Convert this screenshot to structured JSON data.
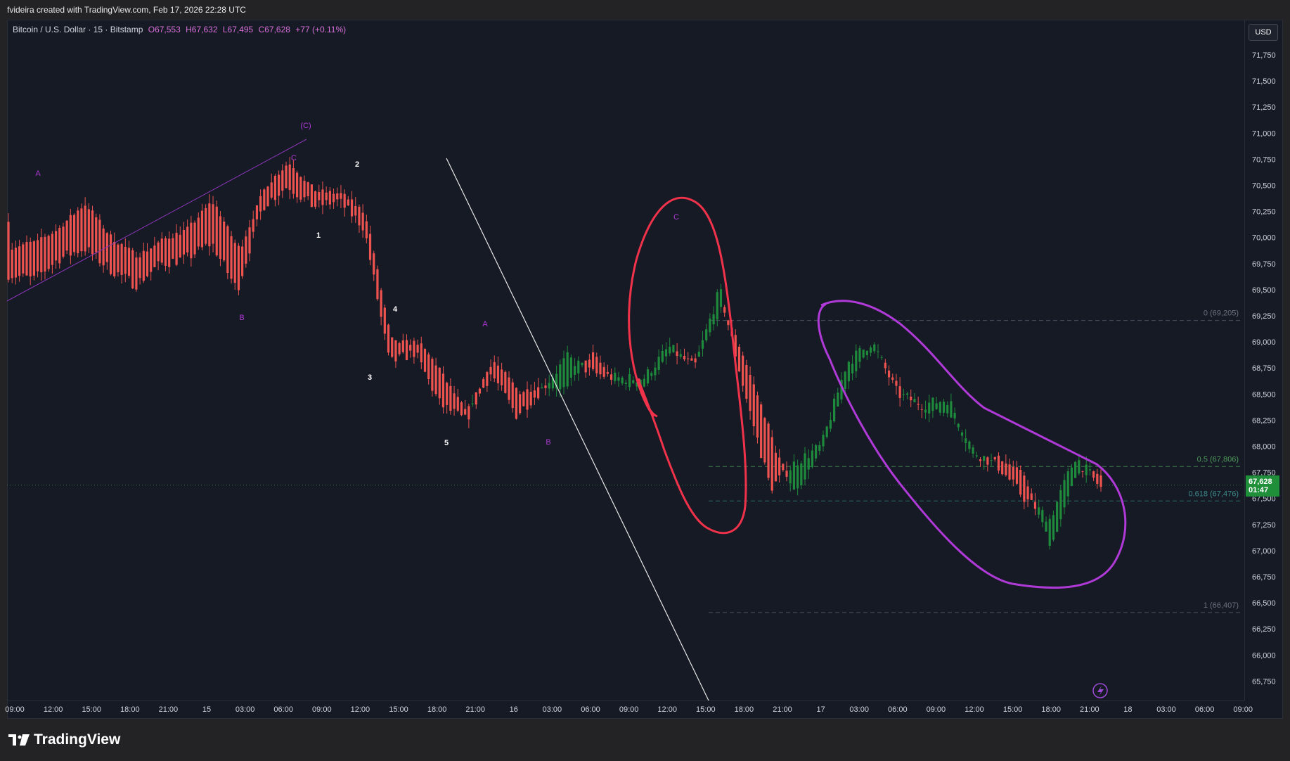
{
  "topline": "fvideira created with TradingView.com, Feb 17, 2026 22:28 UTC",
  "legend": {
    "symbol": "Bitcoin / U.S. Dollar · 15 · Bitstamp",
    "open": "O67,553",
    "high": "H67,632",
    "low": "L67,495",
    "close": "C67,628",
    "change": "+77 (+0.11%)"
  },
  "currency": "USD",
  "last_price": {
    "price": "67,628",
    "countdown": "01:47"
  },
  "price_ticks": [
    "71,750",
    "71,500",
    "71,250",
    "71,000",
    "70,750",
    "70,500",
    "70,250",
    "70,000",
    "69,750",
    "69,500",
    "69,250",
    "69,000",
    "68,750",
    "68,500",
    "68,250",
    "68,000",
    "67,750",
    "67,500",
    "67,250",
    "67,000",
    "66,750",
    "66,500",
    "66,250",
    "66,000",
    "65,750"
  ],
  "time_ticks": [
    "09:00",
    "12:00",
    "15:00",
    "18:00",
    "21:00",
    "15",
    "03:00",
    "06:00",
    "09:00",
    "12:00",
    "15:00",
    "18:00",
    "21:00",
    "16",
    "03:00",
    "06:00",
    "09:00",
    "12:00",
    "15:00",
    "18:00",
    "21:00",
    "17",
    "03:00",
    "06:00",
    "09:00",
    "12:00",
    "15:00",
    "18:00",
    "21:00",
    "18",
    "03:00",
    "06:00",
    "09:00"
  ],
  "fib_levels": [
    {
      "label": "0 (69,205)",
      "price": 69205
    },
    {
      "label": "0.5 (67,806)",
      "price": 67806
    },
    {
      "label": "0.618 (67,476)",
      "price": 67476
    },
    {
      "label": "1 (66,407)",
      "price": 66407
    }
  ],
  "wave_labels": [
    {
      "text": "(C)",
      "color": "purple"
    },
    {
      "text": "A",
      "color": "purple"
    },
    {
      "text": "B",
      "color": "purple"
    },
    {
      "text": "C",
      "color": "purple"
    },
    {
      "text": "1",
      "color": "white"
    },
    {
      "text": "2",
      "color": "white"
    },
    {
      "text": "3",
      "color": "white"
    },
    {
      "text": "4",
      "color": "white"
    },
    {
      "text": "5",
      "color": "white"
    },
    {
      "text": "A",
      "color": "purple"
    },
    {
      "text": "B",
      "color": "purple"
    },
    {
      "text": "C",
      "color": "purple"
    }
  ],
  "colors": {
    "up": "#26a69a",
    "up_candle": "#1e8a3c",
    "down": "#ef5350",
    "purple": "#b03ad8",
    "red_drawing": "#f0324a",
    "background": "#161a25"
  },
  "footer": "TradingView",
  "chart_data": {
    "type": "candlestick",
    "symbol": "BTCUSD",
    "timeframe": "15",
    "ylim": [
      65600,
      71900
    ],
    "y_scale": "linear",
    "grid": false,
    "path_points": [
      [
        70150,
        69650
      ],
      [
        70300,
        69600
      ],
      [
        70400,
        69800
      ],
      [
        70750,
        69900
      ],
      [
        70300,
        69700
      ],
      [
        70100,
        69550
      ],
      [
        70200,
        69750
      ],
      [
        70350,
        69800
      ],
      [
        70750,
        69950
      ],
      [
        70250,
        69500
      ],
      [
        70650,
        70300
      ],
      [
        70950,
        70500
      ],
      [
        70600,
        70300
      ],
      [
        70500,
        70350
      ],
      [
        70350,
        70100
      ],
      [
        69200,
        68800
      ],
      [
        69100,
        68900
      ],
      [
        69000,
        68400
      ],
      [
        68400,
        68250
      ],
      [
        68950,
        68700
      ],
      [
        68750,
        68300
      ],
      [
        68650,
        68550
      ],
      [
        68300,
        68850
      ],
      [
        69050,
        68700
      ],
      [
        68550,
        68650
      ],
      [
        68500,
        68650
      ],
      [
        68850,
        68950
      ],
      [
        68850,
        68750
      ],
      [
        69200,
        69500
      ],
      [
        69000,
        68500
      ],
      [
        68550,
        67600
      ],
      [
        67300,
        67850
      ],
      [
        67950,
        68000
      ],
      [
        68500,
        68800
      ],
      [
        68900,
        69000
      ],
      [
        68600,
        68500
      ],
      [
        68300,
        68400
      ],
      [
        68200,
        68450
      ],
      [
        67800,
        67950
      ],
      [
        67950,
        67800
      ],
      [
        67900,
        67500
      ],
      [
        66800,
        67300
      ],
      [
        67600,
        67900
      ],
      [
        67800,
        67600
      ]
    ]
  }
}
